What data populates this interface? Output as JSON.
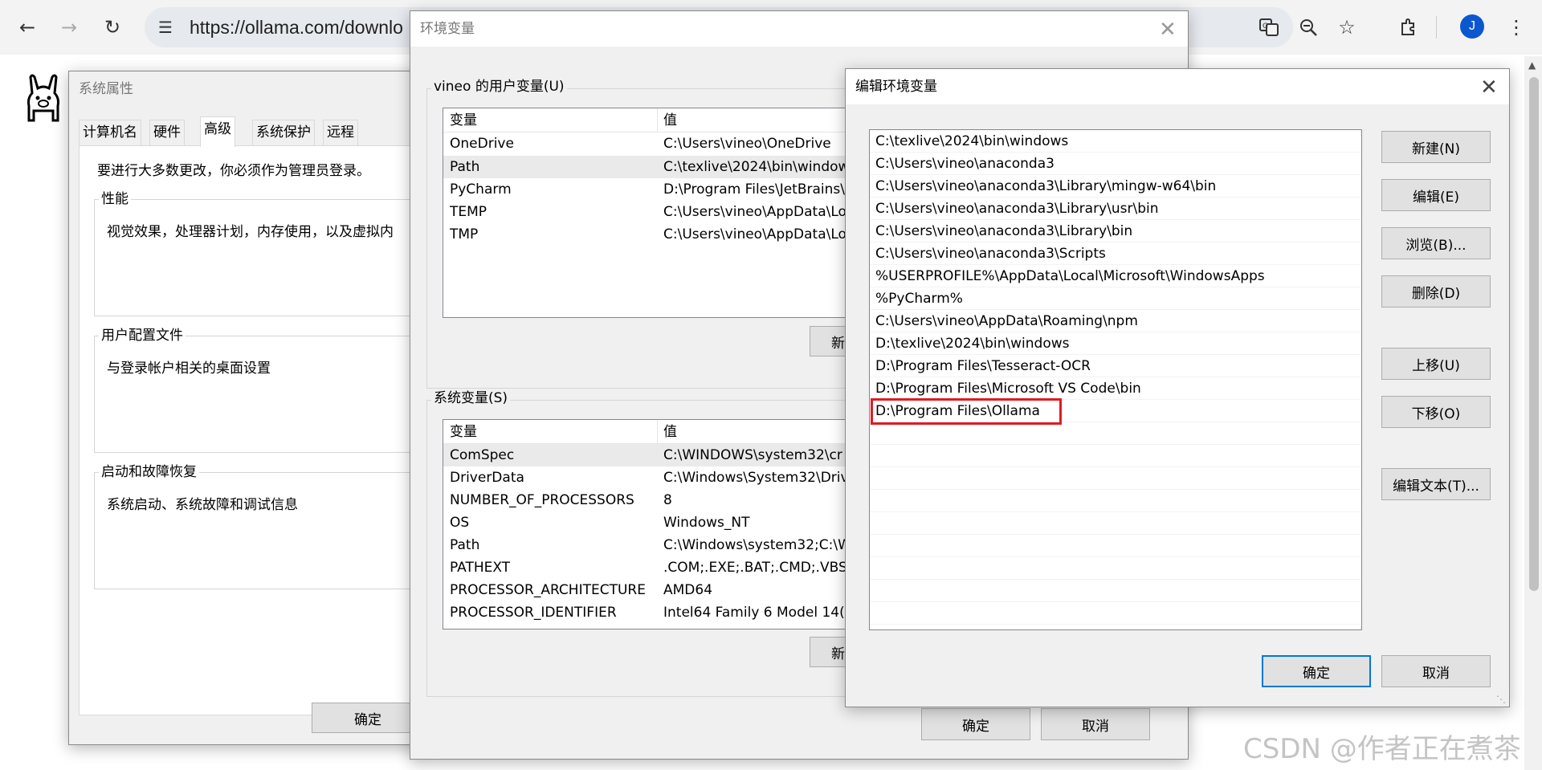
{
  "browser": {
    "url": "https://ollama.com/downlo",
    "avatar_letter": "J",
    "icons": [
      "back-arrow-icon",
      "forward-arrow-icon",
      "reload-icon",
      "site-info-icon",
      "translate-icon",
      "zoom-icon",
      "star-icon",
      "extensions-icon",
      "more-icon"
    ]
  },
  "system_properties": {
    "title": "系统属性",
    "tabs": [
      "计算机名",
      "硬件",
      "高级",
      "系统保护",
      "远程"
    ],
    "active_tab": "高级",
    "admin_note": "要进行大多数更改，你必须作为管理员登录。",
    "groups": [
      {
        "label": "性能",
        "desc": "视觉效果，处理器计划，内存使用，以及虚拟内"
      },
      {
        "label": "用户配置文件",
        "desc": "与登录帐户相关的桌面设置"
      },
      {
        "label": "启动和故障恢复",
        "desc": "系统启动、系统故障和调试信息"
      }
    ],
    "ok_label": "确定"
  },
  "env_vars": {
    "title": "环境变量",
    "user_group_label": "vineo 的用户变量(U)",
    "system_group_label": "系统变量(S)",
    "col_var": "变量",
    "col_val": "值",
    "user_vars": [
      {
        "name": "OneDrive",
        "value": "C:\\Users\\vineo\\OneDrive"
      },
      {
        "name": "Path",
        "value": "C:\\texlive\\2024\\bin\\windows"
      },
      {
        "name": "PyCharm",
        "value": "D:\\Program Files\\JetBrains\\"
      },
      {
        "name": "TEMP",
        "value": "C:\\Users\\vineo\\AppData\\Lo"
      },
      {
        "name": "TMP",
        "value": "C:\\Users\\vineo\\AppData\\Lo"
      }
    ],
    "system_vars": [
      {
        "name": "ComSpec",
        "value": "C:\\WINDOWS\\system32\\cr"
      },
      {
        "name": "DriverData",
        "value": "C:\\Windows\\System32\\Driv"
      },
      {
        "name": "NUMBER_OF_PROCESSORS",
        "value": "8"
      },
      {
        "name": "OS",
        "value": "Windows_NT"
      },
      {
        "name": "Path",
        "value": "C:\\Windows\\system32;C:\\W"
      },
      {
        "name": "PATHEXT",
        "value": ".COM;.EXE;.BAT;.CMD;.VBS;"
      },
      {
        "name": "PROCESSOR_ARCHITECTURE",
        "value": "AMD64"
      },
      {
        "name": "PROCESSOR_IDENTIFIER",
        "value": "Intel64 Family 6 Model 14("
      }
    ],
    "new_button_partial": "新",
    "ok_label": "确定",
    "cancel_label": "取消"
  },
  "edit_env": {
    "title": "编辑环境变量",
    "paths": [
      "C:\\texlive\\2024\\bin\\windows",
      "C:\\Users\\vineo\\anaconda3",
      "C:\\Users\\vineo\\anaconda3\\Library\\mingw-w64\\bin",
      "C:\\Users\\vineo\\anaconda3\\Library\\usr\\bin",
      "C:\\Users\\vineo\\anaconda3\\Library\\bin",
      "C:\\Users\\vineo\\anaconda3\\Scripts",
      "%USERPROFILE%\\AppData\\Local\\Microsoft\\WindowsApps",
      "%PyCharm%",
      "C:\\Users\\vineo\\AppData\\Roaming\\npm",
      "D:\\texlive\\2024\\bin\\windows",
      "D:\\Program Files\\Tesseract-OCR",
      "D:\\Program Files\\Microsoft VS Code\\bin",
      "D:\\Program Files\\Ollama"
    ],
    "highlighted_index": 12,
    "buttons": {
      "new": "新建(N)",
      "edit": "编辑(E)",
      "browse": "浏览(B)...",
      "delete": "删除(D)",
      "move_up": "上移(U)",
      "move_down": "下移(O)",
      "edit_text": "编辑文本(T)..."
    },
    "ok_label": "确定",
    "cancel_label": "取消"
  },
  "watermark": "CSDN @作者正在煮茶",
  "colors": {
    "highlight": "#e01b24",
    "accent": "#0078d7",
    "avatar": "#0b57d0"
  }
}
